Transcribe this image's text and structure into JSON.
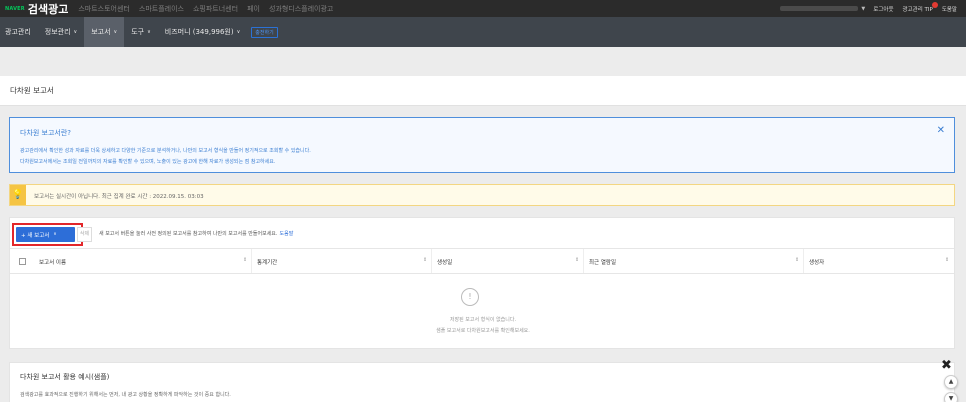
{
  "topbar": {
    "brand_naver": "NAVER",
    "brand_title": "검색광고",
    "services": [
      "스마트스토어센터",
      "스마트플레이스",
      "쇼핑파트너센터",
      "페이",
      "성과형디스플레이광고"
    ],
    "right_links": [
      "로그아웃",
      "광고관리 TIP",
      "도움말"
    ]
  },
  "nav": {
    "items": [
      "광고관리",
      "정보관리",
      "보고서",
      "도구",
      "비즈머니 (349,996원)"
    ],
    "charge_label": "충전하기"
  },
  "page": {
    "title": "다차원 보고서"
  },
  "info": {
    "title": "다차원 보고서란?",
    "line1": "광고관리에서 확인한 성과 자료를 더욱 상세하고 다양한 기준으로 분석하거나, 나만의 보고서 형식을 만들어 정기적으로 조회할 수 있습니다.",
    "line2": "다차원보고서에서는 조회일 전일까지의 자료를 확인할 수 있으며, 노출이 있는 광고에 한해 자료가 생성되는 점 참고하세요.",
    "close_icon": "close-icon"
  },
  "notice": {
    "icon": "lightbulb-icon",
    "text": "보고서는 실시간이 아닙니다. 최근 집계 완료 시간 : 2022.09.15. 03:03"
  },
  "toolbar": {
    "new_report_label": "+ 새 보고서",
    "delete_label": "삭제",
    "hint": "새 보고서 버튼을 눌러 사전 정의된 보고서를 참고하여 나만의 보고서를 만들어보세요.",
    "help_link": "도움말"
  },
  "table": {
    "columns": [
      "보고서 이름",
      "통계기간",
      "생성일",
      "최근 열람일",
      "생성자"
    ],
    "empty_icon": "!",
    "empty_line1": "저장된 보고서 형식이 없습니다.",
    "empty_line2": "샘플 보고서로 다차원보고서를 확인해보세요."
  },
  "bottom": {
    "title": "다차원 보고서 활용 예시(샘플)",
    "subtitle": "검색광고를 효과적으로 진행하기 위해서는 먼저, 내 광고 상황을 정확하게 파악하는 것이 중요 합니다."
  },
  "colors": {
    "primary_blue": "#2d6ed8",
    "highlight_red": "#e3262a",
    "naver_green": "#03c75a",
    "nav_bg": "#3f454c",
    "top_bg": "#2b2b2b"
  }
}
